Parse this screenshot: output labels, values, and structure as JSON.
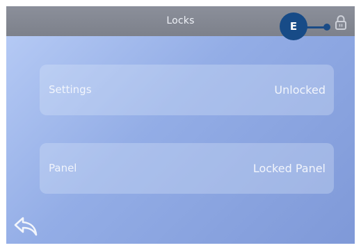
{
  "header": {
    "title": "Locks",
    "lock_icon": "padlock-icon"
  },
  "callout": {
    "label": "E",
    "color": "#174b87"
  },
  "locks": [
    {
      "label": "Settings",
      "value": "Unlocked"
    },
    {
      "label": "Panel",
      "value": "Locked Panel"
    }
  ],
  "footer": {
    "back_icon": "back-arrow-icon"
  },
  "colors": {
    "header_bg": "#858994",
    "screen_bg_light": "#b9cdf6",
    "screen_bg_dark": "#7f99d8",
    "text": "#ffffff"
  }
}
